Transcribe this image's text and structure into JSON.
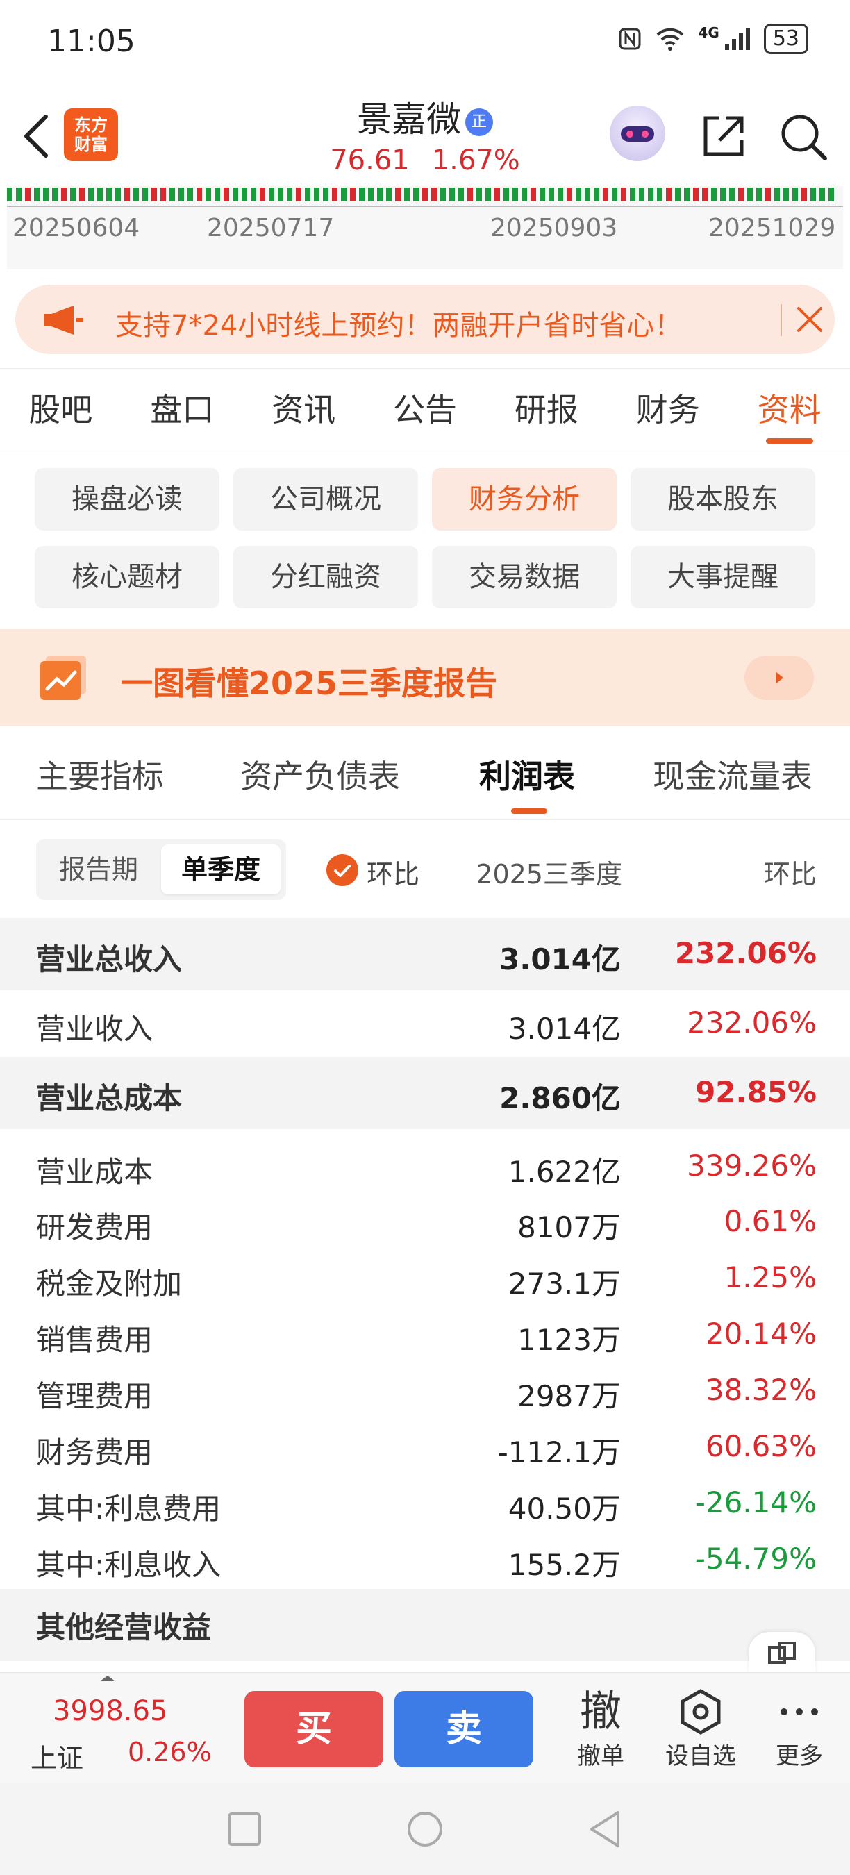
{
  "status_bar": {
    "time": "11:05",
    "network": "4G",
    "battery": "53",
    "icons": [
      "nfc-icon",
      "wifi-icon",
      "signal-icon",
      "battery-icon"
    ]
  },
  "header": {
    "logo_line1": "东方",
    "logo_line2": "财富",
    "stock_name": "景嘉微",
    "badge": "正",
    "price": "76.61",
    "change_pct": "1.67%"
  },
  "mini_chart": {
    "dates": [
      "20250604",
      "20250717",
      "20250903",
      "20251029"
    ]
  },
  "announcement": {
    "text": "支持7*24小时线上预约！两融开户省时省心！"
  },
  "main_tabs": [
    {
      "label": "股吧"
    },
    {
      "label": "盘口"
    },
    {
      "label": "资讯"
    },
    {
      "label": "公告"
    },
    {
      "label": "研报"
    },
    {
      "label": "财务"
    },
    {
      "label": "资料",
      "active": true
    }
  ],
  "sub_nav": [
    {
      "label": "操盘必读"
    },
    {
      "label": "公司概况"
    },
    {
      "label": "财务分析",
      "active": true
    },
    {
      "label": "股本股东"
    },
    {
      "label": "核心题材"
    },
    {
      "label": "分红融资"
    },
    {
      "label": "交易数据"
    },
    {
      "label": "大事提醒"
    }
  ],
  "banner": {
    "text": "一图看懂2025三季度报告"
  },
  "report_tabs": [
    {
      "label": "主要指标"
    },
    {
      "label": "资产负债表"
    },
    {
      "label": "利润表",
      "active": true
    },
    {
      "label": "现金流量表"
    }
  ],
  "controls": {
    "period_options": [
      "报告期",
      "单季度"
    ],
    "active_period": "单季度",
    "qoq_checkbox_label": "环比",
    "qoq_checked": true,
    "col_period": "2025三季度",
    "col_change": "环比"
  },
  "rows": [
    {
      "label": "营业总收入",
      "value": "3.014亿",
      "change": "232.06%",
      "dir": "up",
      "bold": true
    },
    {
      "label": "营业收入",
      "value": "3.014亿",
      "change": "232.06%",
      "dir": "up",
      "bold": false
    },
    {
      "label": "营业总成本",
      "value": "2.860亿",
      "change": "92.85%",
      "dir": "up",
      "bold": true
    },
    {
      "label": "营业成本",
      "value": "1.622亿",
      "change": "339.26%",
      "dir": "up",
      "bold": false
    },
    {
      "label": "研发费用",
      "value": "8107万",
      "change": "0.61%",
      "dir": "up",
      "bold": false
    },
    {
      "label": "税金及附加",
      "value": "273.1万",
      "change": "1.25%",
      "dir": "up",
      "bold": false
    },
    {
      "label": "销售费用",
      "value": "1123万",
      "change": "20.14%",
      "dir": "up",
      "bold": false
    },
    {
      "label": "管理费用",
      "value": "2987万",
      "change": "38.32%",
      "dir": "up",
      "bold": false
    },
    {
      "label": "财务费用",
      "value": "-112.1万",
      "change": "60.63%",
      "dir": "up",
      "bold": false
    },
    {
      "label": "其中:利息费用",
      "value": "40.50万",
      "change": "-26.14%",
      "dir": "down",
      "bold": false
    },
    {
      "label": "其中:利息收入",
      "value": "155.2万",
      "change": "-54.79%",
      "dir": "down",
      "bold": false
    },
    {
      "label": "其他经营收益",
      "value": "",
      "change": "",
      "dir": "up",
      "bold": true
    }
  ],
  "trade_bar": {
    "index_value": "3998.65",
    "index_name": "上证",
    "index_change": "0.26%",
    "buy_label": "买",
    "sell_label": "卖",
    "cancel_icon_char": "撤",
    "cancel_label": "撤单",
    "watchlist_label": "设自选",
    "more_label": "更多"
  },
  "colors": {
    "accent": "#ea5a1f",
    "up": "#d9292c",
    "down": "#1a9b3c",
    "buy": "#e8504f",
    "sell": "#3d7be6"
  }
}
